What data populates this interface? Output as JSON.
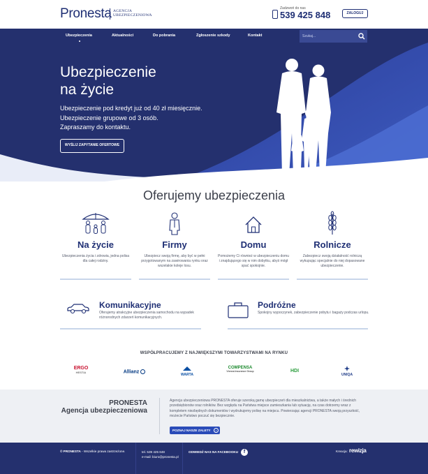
{
  "header": {
    "logo": "Pronesta",
    "logo_sub_line1": "AGENCJA",
    "logo_sub_line2": "UBEZPIECZENIOWA",
    "phone_label": "Zadzwoń do nas",
    "phone_number": "539 425 848",
    "login_label": "ZALOGUJ"
  },
  "nav": {
    "items": [
      {
        "label": "Ubezpieczenia"
      },
      {
        "label": "Aktualności"
      },
      {
        "label": "Do pobrania"
      },
      {
        "label": "Zgłoszenie szkody"
      },
      {
        "label": "Kontakt"
      }
    ],
    "search_placeholder": "Szukaj..."
  },
  "hero": {
    "title_line1": "Ubezpieczenie",
    "title_line2": "na życie",
    "text_line1": "Ubezpieczenie pod kredyt już od 40 zł miesięcznie.",
    "text_line2": "Ubezpieczenie grupowe od 3 osób.",
    "text_line3": "Zapraszamy do kontaktu.",
    "button_label": "WYŚLIJ ZAPYTANIE OFERTOWE"
  },
  "offers": {
    "title": "Oferujemy ubezpieczenia",
    "cards": [
      {
        "icon": "family-umbrella-icon",
        "title": "Na życie",
        "text": "Ubezpieczenia życia i zdrowia, jedna polisa dla całej rodziny."
      },
      {
        "icon": "businessman-icon",
        "title": "Firmy",
        "text": "Ubezpiecz swoją firmę, aby być w pełni przygotowanym na zawirowania rynku oraz wszelakie koleje losu."
      },
      {
        "icon": "house-icon",
        "title": "Domu",
        "text": "Pomożemy Ci również w ubezpieczeniu domu i znajdującego się w nim dobytku, abyś mógł spać spokojnie."
      },
      {
        "icon": "wheat-icon",
        "title": "Rolnicze",
        "text": "Zabezpiecz swoją działalność rolniczą wykupując specjalnie do niej dopasowane ubezpieczenie."
      }
    ],
    "wide": [
      {
        "icon": "car-icon",
        "title": "Komunikacyjne",
        "text": "Oferujemy atrakcyjne ubezpieczenia samochodu na wypadek różnorodnych zdarzeń komunikacyjnych."
      },
      {
        "icon": "suitcase-icon",
        "title": "Podróżne",
        "text": "Spokojny wypoczynek, zabezpieczenie pobytu i bagaży podczas urlopu."
      }
    ]
  },
  "partners": {
    "title": "WSPÓŁPRACUJEMY Z NAJWIĘKSZYMI TOWARZYSTWAMI NA RYNKU",
    "items": [
      {
        "name": "ERGO",
        "sub": "HESTIA",
        "color": "#c8102e"
      },
      {
        "name": "Allianz",
        "color": "#003781"
      },
      {
        "name": "WARTA",
        "color": "#0a4fa3"
      },
      {
        "name": "COMPENSA",
        "sub": "Vienna Insurance Group",
        "color": "#1c8a2e"
      },
      {
        "name": "HDI",
        "color": "#2a9d3c"
      },
      {
        "name": "UNIQA",
        "color": "#1f3c88"
      }
    ]
  },
  "about": {
    "name": "PRONESTA",
    "subtitle": "Agencja ubezpieczeniowa",
    "text": "Agencja ubezpieczeniowa PRONESTA oferuje szeroką gamę ubezpieczeń dla mieszkalnictwa, a także małych i średnich przedsiębiorstw oraz rolników. Bez względu na Państwa miejsce zamieszkania lub sytuację, na czas dotrzemy wraz z kompletem niezbędnych dokumentów i wydrukujemy polisę na miejscu. Powierzając agencji PRONESTA swoją przyszłość, możecie Państwo poczuć się bezpiecznie.",
    "button_label": "POZNAJ NASZE ZALETY"
  },
  "footer": {
    "copyright_brand": "© PRONESTA",
    "copyright_rest": " - Wszelkie prawa zastrzeżone.",
    "tel": "tel. 539 425 848",
    "email": "e-mail: biuro@pronesta.pl",
    "facebook_label": "ODWIEDŹ NAS NA FACEBOOKU",
    "credit_label": "Kreacja:",
    "credit_logo": "rewizja"
  },
  "colors": {
    "navy": "#24306e",
    "accent": "#2a4bb8",
    "text": "#1f2f74"
  }
}
